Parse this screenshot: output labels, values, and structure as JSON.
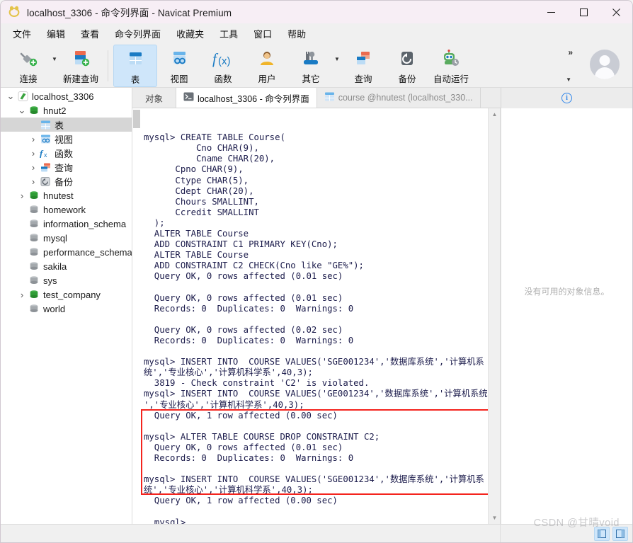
{
  "window": {
    "title": "localhost_3306 - 命令列界面 - Navicat Premium",
    "logo_icon": "navicat-logo-icon",
    "minimize_label": "—",
    "maximize_label": "□",
    "close_label": "✕"
  },
  "menubar": {
    "items": [
      {
        "label": "文件",
        "name": "menu-file"
      },
      {
        "label": "编辑",
        "name": "menu-edit"
      },
      {
        "label": "查看",
        "name": "menu-view"
      },
      {
        "label": "命令列界面",
        "name": "menu-console"
      },
      {
        "label": "收藏夹",
        "name": "menu-favorites"
      },
      {
        "label": "工具",
        "name": "menu-tools"
      },
      {
        "label": "窗口",
        "name": "menu-window"
      },
      {
        "label": "帮助",
        "name": "menu-help"
      }
    ]
  },
  "toolbar": {
    "connection_label": "连接",
    "new_query_label": "新建查询",
    "table_label": "表",
    "view_label": "视图",
    "function_label": "函数",
    "user_label": "用户",
    "other_label": "其它",
    "query_label": "查询",
    "backup_label": "备份",
    "automation_label": "自动运行",
    "overflow_label": "»",
    "overflow_caret": "▼",
    "selected": "表",
    "accent_color": "#1a7bc4",
    "selected_bg": "#cfe6fa"
  },
  "sidebar": {
    "items": [
      {
        "label": "localhost_3306",
        "depth": 0,
        "twisty": "expanded",
        "icon": "navicat-connection-icon",
        "selected": false
      },
      {
        "label": "hnut2",
        "depth": 1,
        "twisty": "expanded",
        "icon": "database-green-icon",
        "selected": false
      },
      {
        "label": "表",
        "depth": 2,
        "twisty": "none",
        "icon": "table-icon",
        "selected": true
      },
      {
        "label": "视图",
        "depth": 2,
        "twisty": "collapsed",
        "icon": "view-icon",
        "selected": false
      },
      {
        "label": "函数",
        "depth": 2,
        "twisty": "collapsed",
        "icon": "function-icon",
        "selected": false
      },
      {
        "label": "查询",
        "depth": 2,
        "twisty": "collapsed",
        "icon": "query-icon",
        "selected": false
      },
      {
        "label": "备份",
        "depth": 2,
        "twisty": "collapsed",
        "icon": "backup-icon",
        "selected": false
      },
      {
        "label": "hnutest",
        "depth": 1,
        "twisty": "collapsed",
        "icon": "database-green-icon",
        "selected": false
      },
      {
        "label": "homework",
        "depth": 1,
        "twisty": "none",
        "icon": "database-gray-icon",
        "selected": false
      },
      {
        "label": "information_schema",
        "depth": 1,
        "twisty": "none",
        "icon": "database-gray-icon",
        "selected": false
      },
      {
        "label": "mysql",
        "depth": 1,
        "twisty": "none",
        "icon": "database-gray-icon",
        "selected": false
      },
      {
        "label": "performance_schema",
        "depth": 1,
        "twisty": "none",
        "icon": "database-gray-icon",
        "selected": false
      },
      {
        "label": "sakila",
        "depth": 1,
        "twisty": "none",
        "icon": "database-gray-icon",
        "selected": false
      },
      {
        "label": "sys",
        "depth": 1,
        "twisty": "none",
        "icon": "database-gray-icon",
        "selected": false
      },
      {
        "label": "test_company",
        "depth": 1,
        "twisty": "collapsed",
        "icon": "database-green-icon",
        "selected": false
      },
      {
        "label": "world",
        "depth": 1,
        "twisty": "none",
        "icon": "database-gray-icon",
        "selected": false
      }
    ]
  },
  "tabs": {
    "objects_label": "对象",
    "items": [
      {
        "label": "localhost_3306 - 命令列界面",
        "icon": "console-icon",
        "active": true
      },
      {
        "label": "course @hnutest (localhost_330...",
        "icon": "table-icon",
        "active": false
      }
    ],
    "info_icon": "info-icon"
  },
  "terminal": {
    "lines": [
      "mysql> CREATE TABLE Course(",
      "          Cno CHAR(9),",
      "          Cname CHAR(20),",
      "      Cpno CHAR(9),",
      "      Ctype CHAR(5),",
      "      Cdept CHAR(20),",
      "      Chours SMALLINT,",
      "      Ccredit SMALLINT",
      "  );",
      "  ALTER TABLE Course",
      "  ADD CONSTRAINT C1 PRIMARY KEY(Cno);",
      "  ALTER TABLE Course",
      "  ADD CONSTRAINT C2 CHECK(Cno like \"GE%\");",
      "  Query OK, 0 rows affected (0.01 sec)",
      "",
      "  Query OK, 0 rows affected (0.01 sec)",
      "  Records: 0  Duplicates: 0  Warnings: 0",
      "",
      "  Query OK, 0 rows affected (0.02 sec)",
      "  Records: 0  Duplicates: 0  Warnings: 0",
      "",
      "mysql> INSERT INTO  COURSE VALUES('SGE001234','数据库系统','计算机系",
      "统','专业核心','计算机科学系',40,3);",
      "  3819 - Check constraint 'C2' is violated.",
      "mysql> INSERT INTO  COURSE VALUES('GE001234','数据库系统','计算机系统",
      "','专业核心','计算机科学系',40,3);",
      "  Query OK, 1 row affected (0.00 sec)",
      "",
      "mysql> ALTER TABLE COURSE DROP CONSTRAINT C2;",
      "  Query OK, 0 rows affected (0.01 sec)",
      "  Records: 0  Duplicates: 0  Warnings: 0",
      "",
      "mysql> INSERT INTO  COURSE VALUES('SGE001234','数据库系统','计算机系",
      "统','专业核心','计算机科学系',40,3);",
      "  Query OK, 1 row affected (0.00 sec)",
      "",
      "  mysql>"
    ],
    "highlight_color": "#f4241e",
    "text_color": "#1b1b4b"
  },
  "right_panel": {
    "empty_message": "没有可用的对象信息。"
  },
  "statusbar": {
    "toggle_left_label": "panel-toggle-left",
    "toggle_right_label": "panel-toggle-right"
  },
  "watermark": {
    "text": "CSDN @甘晴void"
  }
}
